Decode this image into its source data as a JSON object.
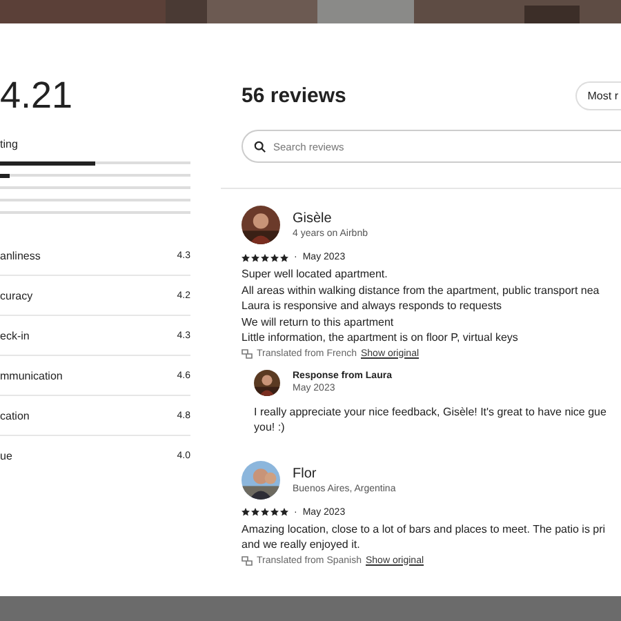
{
  "overall": {
    "score": "4.21",
    "label": "ting",
    "bars": [
      {
        "kind": "filled",
        "level": 0.5
      },
      {
        "kind": "filled",
        "level": 0.05
      },
      {
        "kind": "empty"
      },
      {
        "kind": "empty"
      },
      {
        "kind": "empty"
      }
    ]
  },
  "categories": [
    {
      "name": "anliness",
      "score": "4.3"
    },
    {
      "name": "curacy",
      "score": "4.2"
    },
    {
      "name": "eck-in",
      "score": "4.3"
    },
    {
      "name": "mmunication",
      "score": "4.6"
    },
    {
      "name": "cation",
      "score": "4.8"
    },
    {
      "name": "ue",
      "score": "4.0"
    }
  ],
  "date_separator": "·",
  "reviews_title": "56 reviews",
  "sort_button": "Most r",
  "search": {
    "placeholder": "Search reviews"
  },
  "reviews": [
    {
      "name": "Gisèle",
      "subtitle": "4 years on Airbnb",
      "stars": 5,
      "date": "May 2023",
      "lines": [
        "Super well located apartment.",
        "All areas within walking distance from the apartment, public transport nea",
        "Laura is responsive and always responds to requests",
        "We will return to this apartment",
        "Little information, the apartment is on floor P, virtual keys"
      ],
      "translated": "Translated from French",
      "show_original": "Show original",
      "response": {
        "title": "Response from Laura",
        "date": "May 2023",
        "lines": [
          "I really appreciate your nice feedback, Gisèle! It's great to have nice gue",
          "you! :)"
        ]
      }
    },
    {
      "name": "Flor",
      "subtitle": "Buenos Aires, Argentina",
      "stars": 5,
      "date": "May 2023",
      "lines": [
        "Amazing location, close to a lot of bars and places to meet. The patio is pri",
        "and we really enjoyed it."
      ],
      "translated": "Translated from Spanish",
      "show_original": "Show original"
    }
  ]
}
